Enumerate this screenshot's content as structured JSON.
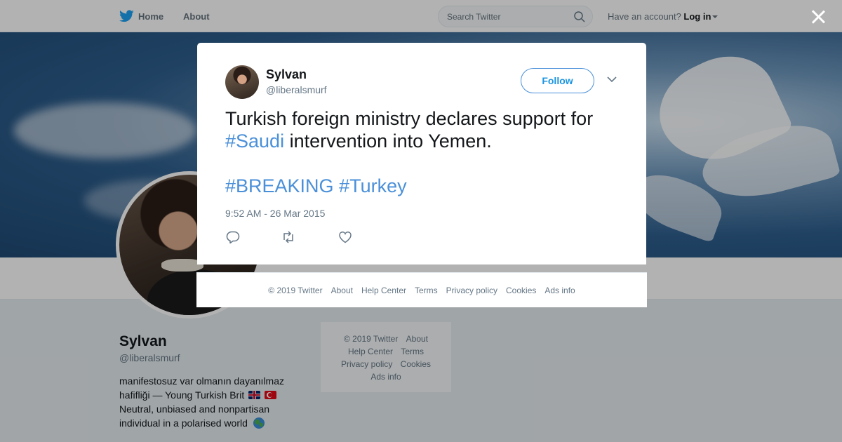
{
  "nav": {
    "home_label": "Home",
    "about_label": "About",
    "search_placeholder": "Search Twitter",
    "account_prompt": "Have an account?",
    "login_label": "Log in"
  },
  "profile": {
    "name": "Sylvan",
    "handle": "@liberalsmurf",
    "bio_line1": "manifestosuz var olmanın dayanılmaz",
    "bio_line2": "hafifliği — Young Turkish Brit",
    "bio_line3": "Neutral, unbiased and nonpartisan",
    "bio_line4": "individual in a polarised world"
  },
  "side_footer": {
    "copyright": "© 2019 Twitter",
    "about": "About",
    "help": "Help Center",
    "terms": "Terms",
    "privacy": "Privacy policy",
    "cookies": "Cookies",
    "ads": "Ads info"
  },
  "tweet": {
    "author_name": "Sylvan",
    "author_handle": "@liberalsmurf",
    "follow_label": "Follow",
    "text_part1": "Turkish foreign ministry declares support for",
    "hashtag1": "#Saudi",
    "text_part2": " intervention into Yemen.",
    "hashtag2": "#BREAKING",
    "hashtag3": "#Turkey",
    "timestamp": "9:52 AM - 26 Mar 2015"
  },
  "modal_footer": {
    "copyright": "© 2019 Twitter",
    "about": "About",
    "help": "Help Center",
    "terms": "Terms",
    "privacy": "Privacy policy",
    "cookies": "Cookies",
    "ads": "Ads info"
  },
  "colors": {
    "accent": "#1b95e0",
    "hashtag": "#4a90d9",
    "text": "#14171a",
    "muted": "#657786"
  },
  "icons": [
    "twitter-bird-icon",
    "search-icon",
    "close-icon",
    "chevron-down-icon",
    "reply-icon",
    "retweet-icon",
    "like-icon"
  ]
}
